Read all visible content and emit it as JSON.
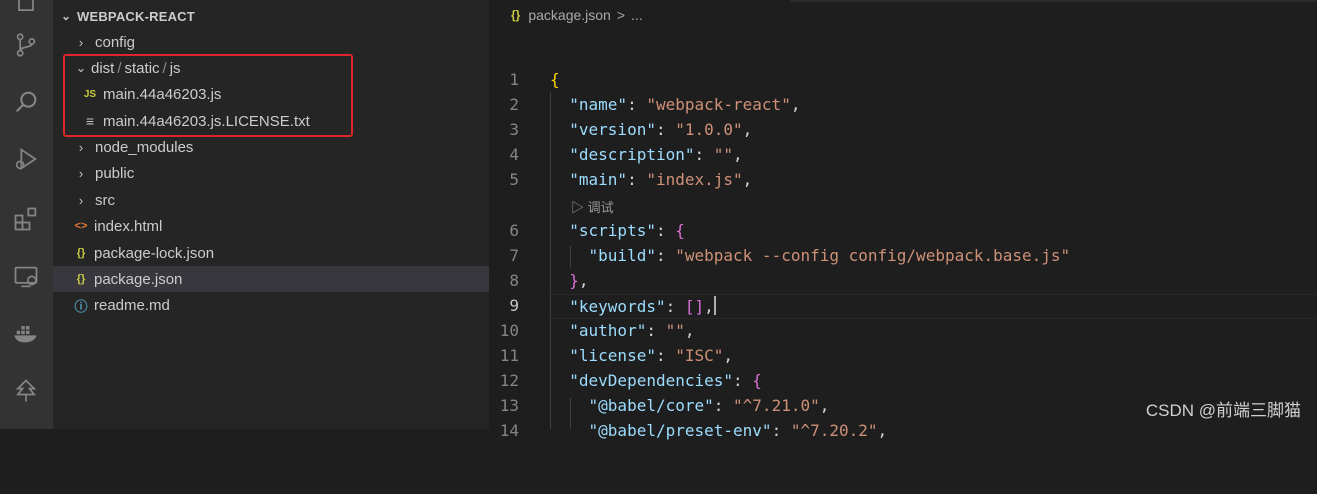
{
  "sidebar": {
    "title": "WEBPACK-REACT",
    "items": [
      {
        "label": "config",
        "kind": "folder",
        "expanded": false
      },
      {
        "label_parts": [
          "dist",
          "static",
          "js"
        ],
        "kind": "folder",
        "expanded": true
      },
      {
        "label": "main.44a46203.js",
        "kind": "js-file",
        "icon_text": "JS"
      },
      {
        "label": "main.44a46203.js.LICENSE.txt",
        "kind": "text-file"
      },
      {
        "label": "node_modules",
        "kind": "folder",
        "expanded": false
      },
      {
        "label": "public",
        "kind": "folder",
        "expanded": false
      },
      {
        "label": "src",
        "kind": "folder",
        "expanded": false
      },
      {
        "label": "index.html",
        "kind": "html-file",
        "icon_text": "<>"
      },
      {
        "label": "package-lock.json",
        "kind": "json-file",
        "icon_text": "{}"
      },
      {
        "label": "package.json",
        "kind": "json-file",
        "icon_text": "{}",
        "selected": true
      },
      {
        "label": "readme.md",
        "kind": "md-file",
        "icon_text": "ⓘ"
      }
    ]
  },
  "breadcrumb": {
    "file": "package.json",
    "separator": ">",
    "ellipsis": "..."
  },
  "codelens": "▷ 调试",
  "code_lines": [
    {
      "n": "1",
      "text": "{"
    },
    {
      "n": "2",
      "key": "\"name\"",
      "value": "\"webpack-react\"",
      "tail": ","
    },
    {
      "n": "3",
      "key": "\"version\"",
      "value": "\"1.0.0\"",
      "tail": ","
    },
    {
      "n": "4",
      "key": "\"description\"",
      "value": "\"\"",
      "tail": ","
    },
    {
      "n": "5",
      "key": "\"main\"",
      "value": "\"index.js\"",
      "tail": ","
    },
    {
      "n": "6",
      "key": "\"scripts\"",
      "open": "{"
    },
    {
      "n": "7",
      "key": "\"build\"",
      "value": "\"webpack --config config/webpack.base.js\""
    },
    {
      "n": "8",
      "close": "}",
      "tail": ","
    },
    {
      "n": "9",
      "key": "\"keywords\"",
      "array": "[]",
      "tail": ","
    },
    {
      "n": "10",
      "key": "\"author\"",
      "value": "\"\"",
      "tail": ","
    },
    {
      "n": "11",
      "key": "\"license\"",
      "value": "\"ISC\"",
      "tail": ","
    },
    {
      "n": "12",
      "key": "\"devDependencies\"",
      "open": "{"
    },
    {
      "n": "13",
      "key": "\"@babel/core\"",
      "value": "\"^7.21.0\"",
      "tail": ","
    },
    {
      "n": "14",
      "key": "\"@babel/preset-env\"",
      "value": "\"^7.20.2\"",
      "tail": ","
    }
  ],
  "watermark": "CSDN @前端三脚猫",
  "colors": {
    "key": "#9cdcfe",
    "string": "#ce9178",
    "brace_outer": "#ffd700",
    "brace_inner": "#da70d6",
    "highlight_box": "#e0242b"
  },
  "activity_icons": [
    "explorer-icon",
    "source-control-icon",
    "search-icon",
    "run-debug-icon",
    "extensions-icon",
    "remote-explorer-icon",
    "docker-icon",
    "tree-icon"
  ]
}
